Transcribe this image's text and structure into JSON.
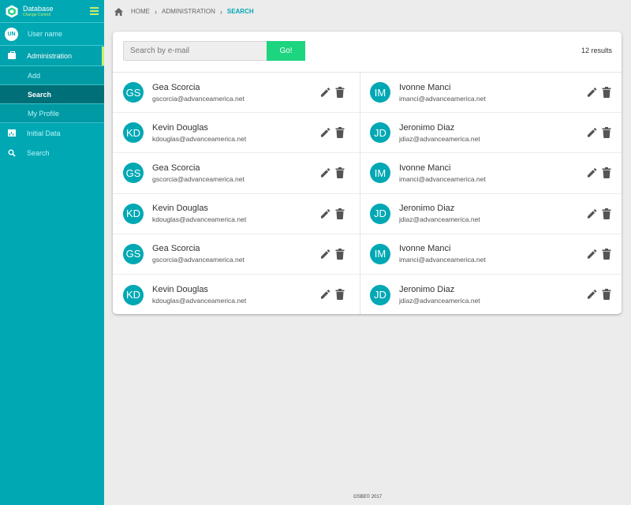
{
  "sidebar": {
    "brand_title": "Database",
    "brand_subtitle": "Change Control",
    "user_initials": "UN",
    "user_name": "User name",
    "administration": "Administration",
    "sub_items": [
      "Add",
      "Search",
      "My Profile"
    ],
    "initial_data": "Initial Data",
    "search": "Search"
  },
  "breadcrumb": {
    "home": "HOME",
    "administration": "ADMINISTRATION",
    "current": "SEARCH"
  },
  "search": {
    "placeholder": "Search by e-mail",
    "button": "Go!",
    "results": "12 results"
  },
  "users": [
    {
      "initials": "GS",
      "name": "Gea Scorcia",
      "email": "gscorcia@advanceamerica.net"
    },
    {
      "initials": "IM",
      "name": "Ivonne Manci",
      "email": "imanci@advanceamerica.net"
    },
    {
      "initials": "KD",
      "name": "Kevin Douglas",
      "email": "kdouglas@advanceamerica.net"
    },
    {
      "initials": "JD",
      "name": "Jeronimo Diaz",
      "email": "jdiaz@advanceamerica.net"
    },
    {
      "initials": "GS",
      "name": "Gea Scorcia",
      "email": "gscorcia@advanceamerica.net"
    },
    {
      "initials": "IM",
      "name": "Ivonne Manci",
      "email": "imanci@advanceamerica.net"
    },
    {
      "initials": "KD",
      "name": "Kevin Douglas",
      "email": "kdouglas@advanceamerica.net"
    },
    {
      "initials": "JD",
      "name": "Jeronimo Diaz",
      "email": "jdiaz@advanceamerica.net"
    },
    {
      "initials": "GS",
      "name": "Gea Scorcia",
      "email": "gscorcia@advanceamerica.net"
    },
    {
      "initials": "IM",
      "name": "Ivonne Manci",
      "email": "imanci@advanceamerica.net"
    },
    {
      "initials": "KD",
      "name": "Kevin Douglas",
      "email": "kdouglas@advanceamerica.net"
    },
    {
      "initials": "JD",
      "name": "Jeronimo Diaz",
      "email": "jdiaz@advanceamerica.net"
    }
  ],
  "footer": "GSBE© 2017",
  "colors": {
    "sidebar": "#00a8b4",
    "accent_lime": "#c8f06a",
    "go_button": "#1dd47f",
    "active_item": "#006f77"
  },
  "icons": {
    "brand": "hexagon-logo-icon",
    "menu": "hamburger-icon",
    "administration": "briefcase-icon",
    "initial_data": "chart-icon",
    "search": "search-icon",
    "home": "home-icon",
    "edit": "pencil-icon",
    "delete": "trash-icon"
  }
}
